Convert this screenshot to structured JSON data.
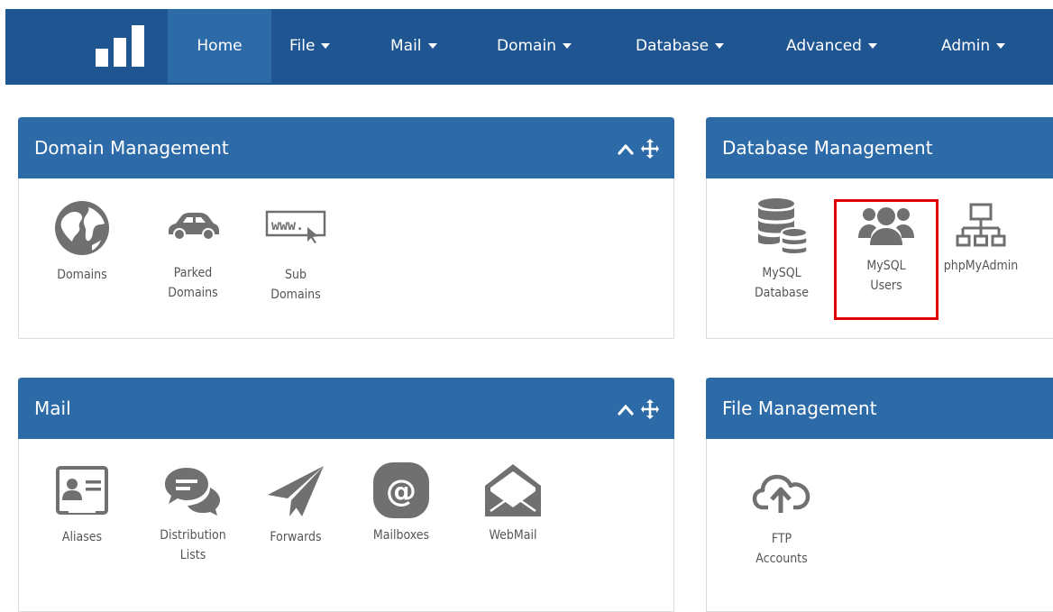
{
  "nav": {
    "items": [
      {
        "label": "Home",
        "dropdown": false
      },
      {
        "label": "File",
        "dropdown": true
      },
      {
        "label": "Mail",
        "dropdown": true
      },
      {
        "label": "Domain",
        "dropdown": true
      },
      {
        "label": "Database",
        "dropdown": true
      },
      {
        "label": "Advanced",
        "dropdown": true
      },
      {
        "label": "Admin",
        "dropdown": true
      }
    ]
  },
  "panels": {
    "domain": {
      "title": "Domain Management",
      "items": [
        {
          "label": "Domains",
          "icon": "globe-icon"
        },
        {
          "label": "Parked\nDomains",
          "icon": "car-icon"
        },
        {
          "label": "Sub\nDomains",
          "icon": "www-cursor-icon"
        }
      ]
    },
    "database": {
      "title": "Database Management",
      "items": [
        {
          "label": "MySQL\nDatabase",
          "icon": "database-stack-icon"
        },
        {
          "label": "MySQL\nUsers",
          "icon": "users-group-icon",
          "highlighted": true
        },
        {
          "label": "phpMyAdmin",
          "icon": "sitemap-icon"
        }
      ]
    },
    "mail": {
      "title": "Mail",
      "items": [
        {
          "label": "Aliases",
          "icon": "contact-card-icon"
        },
        {
          "label": "Distribution\nLists",
          "icon": "chat-bubbles-icon"
        },
        {
          "label": "Forwards",
          "icon": "paper-plane-icon"
        },
        {
          "label": "Mailboxes",
          "icon": "at-sign-icon"
        },
        {
          "label": "WebMail",
          "icon": "open-envelope-icon"
        }
      ]
    },
    "file": {
      "title": "File Management",
      "items": [
        {
          "label": "FTP\nAccounts",
          "icon": "cloud-upload-icon"
        }
      ]
    }
  },
  "colors": {
    "nav_bg": "#1f5691",
    "panel_header": "#2d6aa8",
    "icon": "#707070",
    "highlight": "#e00000"
  }
}
